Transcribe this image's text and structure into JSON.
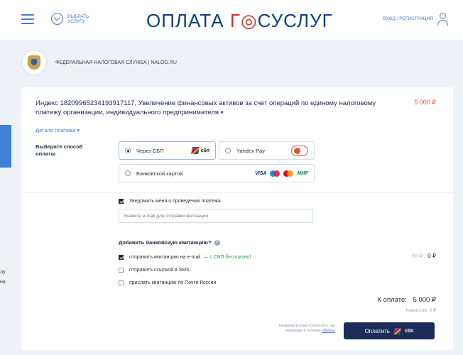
{
  "header": {
    "service_button": "ВЫБРАТЬ УСЛУГУ",
    "logo_left": "ОПЛАТА",
    "logo_right": "СУСЛУГ",
    "login": "ВХОД / РЕГИСТРАЦИЯ"
  },
  "organization": {
    "name": "ФЕДЕРАЛЬНАЯ НАЛОГОВАЯ СЛУЖБА | nalog.ru"
  },
  "left_panel": {
    "label1": "лу",
    "label2": "на"
  },
  "payment": {
    "title": "Индекс 18209965234193917117, Увеличение финансовых активов за счет операций по единому налоговому платежу организации, индивидуального предпринимателя",
    "amount": "5 000 ₽",
    "details_link": "Детали платежа"
  },
  "method": {
    "label": "Выберите способ оплаты",
    "options": [
      {
        "label": "Через СБП",
        "selected": true,
        "badge": "сбп"
      },
      {
        "label": "Yandex Pay",
        "selected": false
      },
      {
        "label": "Банковской картой",
        "selected": false,
        "badges": [
          "VISA",
          "МИР"
        ]
      }
    ]
  },
  "notify": {
    "label": "Уведомить меня о проведении платежа",
    "checked": true,
    "email_placeholder": "Укажите e-mail для отправки квитанции"
  },
  "receipt": {
    "heading": "Добавить банковскую квитанцию?",
    "options": [
      {
        "label": "отправить квитанцию на e-mail",
        "extra": "— с СБП бесплатно!",
        "checked": true
      },
      {
        "label": "отправить ссылкой в SMS",
        "checked": false
      },
      {
        "label": "прислать квитанцию по Почте России",
        "checked": false
      }
    ],
    "old_price": "59 ₽",
    "new_price": "0 ₽"
  },
  "summary": {
    "total_label": "К оплате:",
    "total_value": "5 000 ₽",
    "commission": "Комиссия: 0 ₽"
  },
  "footer": {
    "note": "Нажимая кнопку «Оплатить», вы принимаете условия",
    "note_link": "оферты",
    "pay_button": "Оплатить",
    "pay_badge": "сбп"
  }
}
